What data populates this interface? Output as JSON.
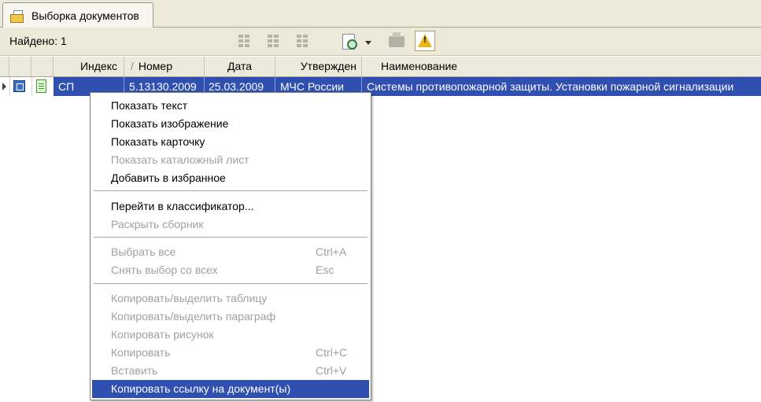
{
  "tab": {
    "label": "Выборка документов",
    "icon": "folder-documents-icon"
  },
  "toolbar": {
    "found_label": "Найдено: 1",
    "icons": [
      "grid-view-icon",
      "grid-view-icon",
      "grid-view-icon",
      "zoom-preview-icon",
      "dropdown-arrow-icon",
      "printer-icon",
      "warning-icon"
    ]
  },
  "table": {
    "columns": [
      "Индекс",
      "Номер",
      "Дата",
      "Утвержден",
      "Наименование"
    ],
    "sort_marker": "/",
    "rows": [
      {
        "index": "СП",
        "number": "5.13130.2009",
        "date": "25.03.2009",
        "approved": "МЧС России",
        "name": "Системы противопожарной защиты. Установки пожарной сигнализации"
      }
    ]
  },
  "context_menu": {
    "items": [
      {
        "label": "Показать текст",
        "enabled": true
      },
      {
        "label": "Показать изображение",
        "enabled": true
      },
      {
        "label": "Показать карточку",
        "enabled": true
      },
      {
        "label": "Показать каталожный лист",
        "enabled": false
      },
      {
        "label": "Добавить в избранное",
        "enabled": true
      },
      {
        "label": "Перейти в классификатор...",
        "enabled": true
      },
      {
        "label": "Раскрыть сборник",
        "enabled": false
      },
      {
        "label": "Выбрать все",
        "enabled": false,
        "shortcut": "Ctrl+A"
      },
      {
        "label": "Снять выбор со всех",
        "enabled": false,
        "shortcut": "Esc"
      },
      {
        "label": "Копировать/выделить таблицу",
        "enabled": false
      },
      {
        "label": "Копировать/выделить параграф",
        "enabled": false
      },
      {
        "label": "Копировать рисунок",
        "enabled": false
      },
      {
        "label": "Копировать",
        "enabled": false,
        "shortcut": "Ctrl+C"
      },
      {
        "label": "Вставить",
        "enabled": false,
        "shortcut": "Ctrl+V"
      },
      {
        "label": "Копировать ссылку на документ(ы)",
        "enabled": true,
        "highlighted": true
      }
    ]
  },
  "colors": {
    "selection": "#2f4fb1",
    "chrome": "#ece9d8",
    "disabled_text": "#a0a0a0",
    "warning": "#e8b51a"
  }
}
